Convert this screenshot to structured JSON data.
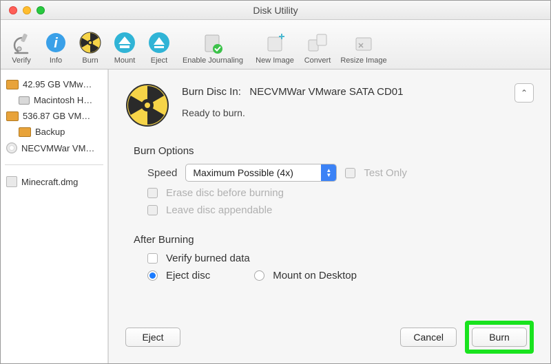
{
  "window": {
    "title": "Disk Utility"
  },
  "toolbar": {
    "items": [
      {
        "label": "Verify"
      },
      {
        "label": "Info"
      },
      {
        "label": "Burn"
      },
      {
        "label": "Mount"
      },
      {
        "label": "Eject"
      },
      {
        "label": "Enable Journaling"
      },
      {
        "label": "New Image"
      },
      {
        "label": "Convert"
      },
      {
        "label": "Resize Image"
      }
    ]
  },
  "sidebar": {
    "disk1": "42.95 GB VMw…",
    "disk1_vol": "Macintosh H…",
    "disk2": "536.87 GB VM…",
    "disk2_vol": "Backup",
    "optical": "NECVMWar VM…",
    "dmg": "Minecraft.dmg"
  },
  "dialog": {
    "burn_in_label": "Burn Disc In:",
    "burn_in_value": "NECVMWar VMware SATA CD01",
    "status": "Ready to burn.",
    "options_title": "Burn Options",
    "speed_label": "Speed",
    "speed_value": "Maximum Possible (4x)",
    "test_only": "Test Only",
    "erase_before": "Erase disc before burning",
    "leave_appendable": "Leave disc appendable",
    "after_title": "After Burning",
    "verify_burned": "Verify burned data",
    "eject_disc": "Eject disc",
    "mount_desktop": "Mount on Desktop",
    "buttons": {
      "eject": "Eject",
      "cancel": "Cancel",
      "burn": "Burn"
    }
  }
}
